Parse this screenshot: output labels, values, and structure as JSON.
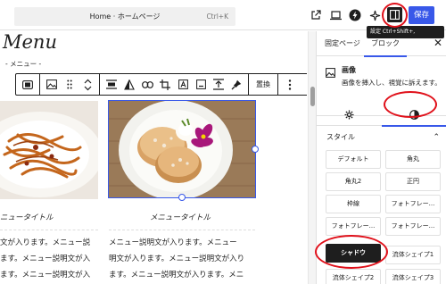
{
  "topbar": {
    "address_text": "Home · ホームページ",
    "shortcut": "Ctrl+K",
    "save_label": "保存",
    "tooltip_text": "設定  Ctrl+Shift+,"
  },
  "canvas": {
    "menu_title": "Menu",
    "menu_subtitle": "- メニュー -",
    "toolbar": {
      "replace_label": "置換"
    },
    "captions": [
      "ニュータイトル",
      "メニュータイトル"
    ],
    "desc_left": [
      "文が入ります。メニュー説",
      "ます。メニュー説明文が入",
      "ます。メニュー説明文が入"
    ],
    "desc_right": [
      "メニュー説明文が入ります。メニュー",
      "明文が入ります。メニュー説明文が入り",
      "ます。メニュー説明文が入ります。メニ"
    ]
  },
  "sidebar": {
    "tabs": [
      {
        "label": "固定ページ",
        "active": false
      },
      {
        "label": "ブロック",
        "active": true
      }
    ],
    "block_title": "画像",
    "block_desc": "画像を挿入し、視覚に訴えます。",
    "section_label": "スタイル",
    "styles": [
      {
        "label": "デフォルト",
        "selected": false
      },
      {
        "label": "角丸",
        "selected": false
      },
      {
        "label": "角丸2",
        "selected": false
      },
      {
        "label": "正円",
        "selected": false
      },
      {
        "label": "枠線",
        "selected": false
      },
      {
        "label": "フォトフレー...",
        "selected": false
      },
      {
        "label": "フォトフレー...",
        "selected": false
      },
      {
        "label": "フォトフレー...",
        "selected": false
      },
      {
        "label": "シャドウ",
        "selected": true
      },
      {
        "label": "流体シェイプ1",
        "selected": false
      },
      {
        "label": "流体シェイプ2",
        "selected": false
      },
      {
        "label": "流体シェイプ3",
        "selected": false
      }
    ]
  },
  "colors": {
    "accent": "#3858e9",
    "highlight_circle": "#e0101a",
    "dark": "#1e1e1e"
  }
}
